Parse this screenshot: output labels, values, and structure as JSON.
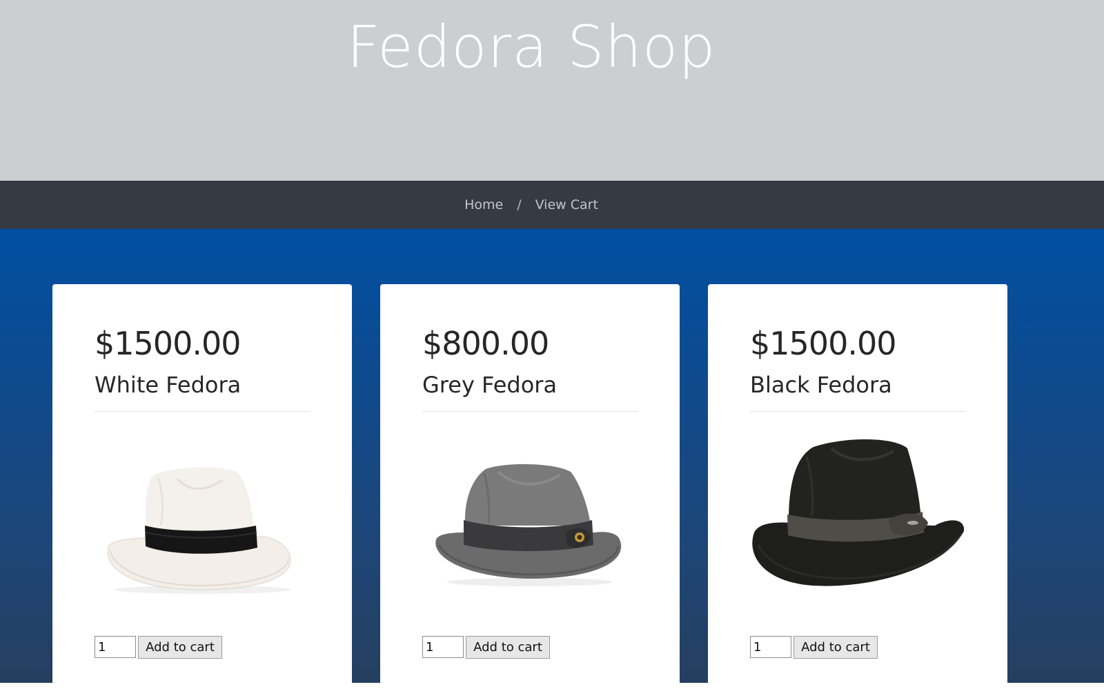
{
  "header": {
    "title": "Fedora Shop"
  },
  "nav": {
    "breadcrumb": [
      {
        "label": "Home"
      },
      {
        "label": "View Cart"
      }
    ],
    "separator": "/"
  },
  "colors": {
    "hero_bg": "#ccced1",
    "navbar_bg": "#353a43",
    "main_gradient_top": "#014fa3",
    "main_gradient_bottom": "#253f5f",
    "card_bg": "#ffffff"
  },
  "products": [
    {
      "price": "$1500.00",
      "name": "White Fedora",
      "image_icon": "white-fedora-image",
      "quantity": "1",
      "button_label": "Add to cart"
    },
    {
      "price": "$800.00",
      "name": "Grey Fedora",
      "image_icon": "grey-fedora-image",
      "quantity": "1",
      "button_label": "Add to cart"
    },
    {
      "price": "$1500.00",
      "name": "Black Fedora",
      "image_icon": "black-fedora-image",
      "quantity": "1",
      "button_label": "Add to cart"
    }
  ]
}
